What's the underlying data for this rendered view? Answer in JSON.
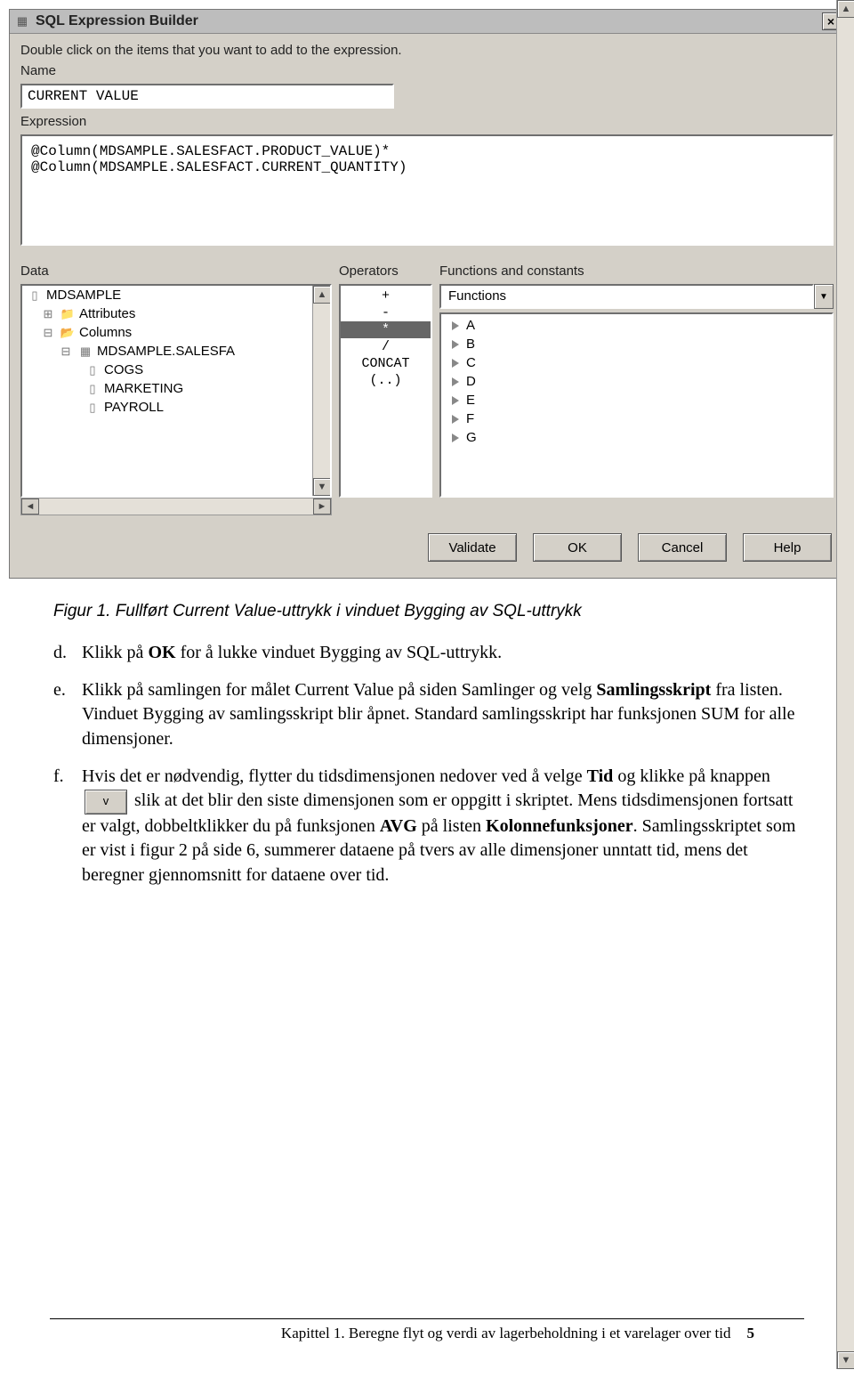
{
  "window": {
    "title": "SQL Expression Builder",
    "instruct": "Double click on the items that you want to add to the expression.",
    "labels": {
      "name": "Name",
      "expression": "Expression",
      "data": "Data",
      "operators": "Operators",
      "functions": "Functions and constants"
    },
    "name_value": "CURRENT VALUE",
    "expr_l1": "@Column(MDSAMPLE.SALESFACT.PRODUCT_VALUE)*",
    "expr_l2": "@Column(MDSAMPLE.SALESFACT.CURRENT_QUANTITY)",
    "data_tree": [
      "MDSAMPLE",
      "Attributes",
      "Columns",
      "MDSAMPLE.SALESFA",
      "COGS",
      "MARKETING",
      "PAYROLL"
    ],
    "operators": [
      "+",
      "-",
      "*",
      "/",
      "CONCAT",
      "(..)"
    ],
    "fn_combo": "Functions",
    "fn_items": [
      "A",
      "B",
      "C",
      "D",
      "E",
      "F",
      "G"
    ],
    "buttons": {
      "validate": "Validate",
      "ok": "OK",
      "cancel": "Cancel",
      "help": "Help"
    }
  },
  "doc": {
    "caption": "Figur 1. Fullført Current Value-uttrykk i vinduet Bygging av SQL-uttrykk",
    "step_d_m": "d.",
    "step_d_1": "Klikk på ",
    "step_d_b": "OK",
    "step_d_2": " for å lukke vinduet Bygging av SQL-uttrykk.",
    "step_e_m": "e.",
    "step_e_1": "Klikk på samlingen for målet Current Value på siden Samlinger og velg ",
    "step_e_b": "Samlingsskript",
    "step_e_2": " fra listen. Vinduet Bygging av samlingsskript blir åpnet. Standard samlingsskript har funksjonen SUM for alle dimensjoner.",
    "step_f_m": "f.",
    "step_f_1": "Hvis det er nødvendig, flytter du tidsdimensjonen nedover ved å velge ",
    "step_f_b1": "Tid",
    "step_f_2": " og klikke på knappen ",
    "step_f_btn": "v",
    "step_f_3": " slik at det blir den siste dimensjonen som er oppgitt i skriptet. Mens tidsdimensjonen fortsatt er valgt, dobbeltklikker du på funksjonen ",
    "step_f_b2": "AVG",
    "step_f_4": " på listen ",
    "step_f_b3": "Kolonnefunksjoner",
    "step_f_5": ". Samlingsskriptet som er vist i figur 2 på side 6, summerer dataene på tvers av alle dimensjoner unntatt tid, mens det beregner gjennomsnitt for dataene over tid.",
    "footer_t": "Kapittel 1. Beregne flyt og verdi av lagerbeholdning i et varelager over tid",
    "footer_p": "5"
  }
}
